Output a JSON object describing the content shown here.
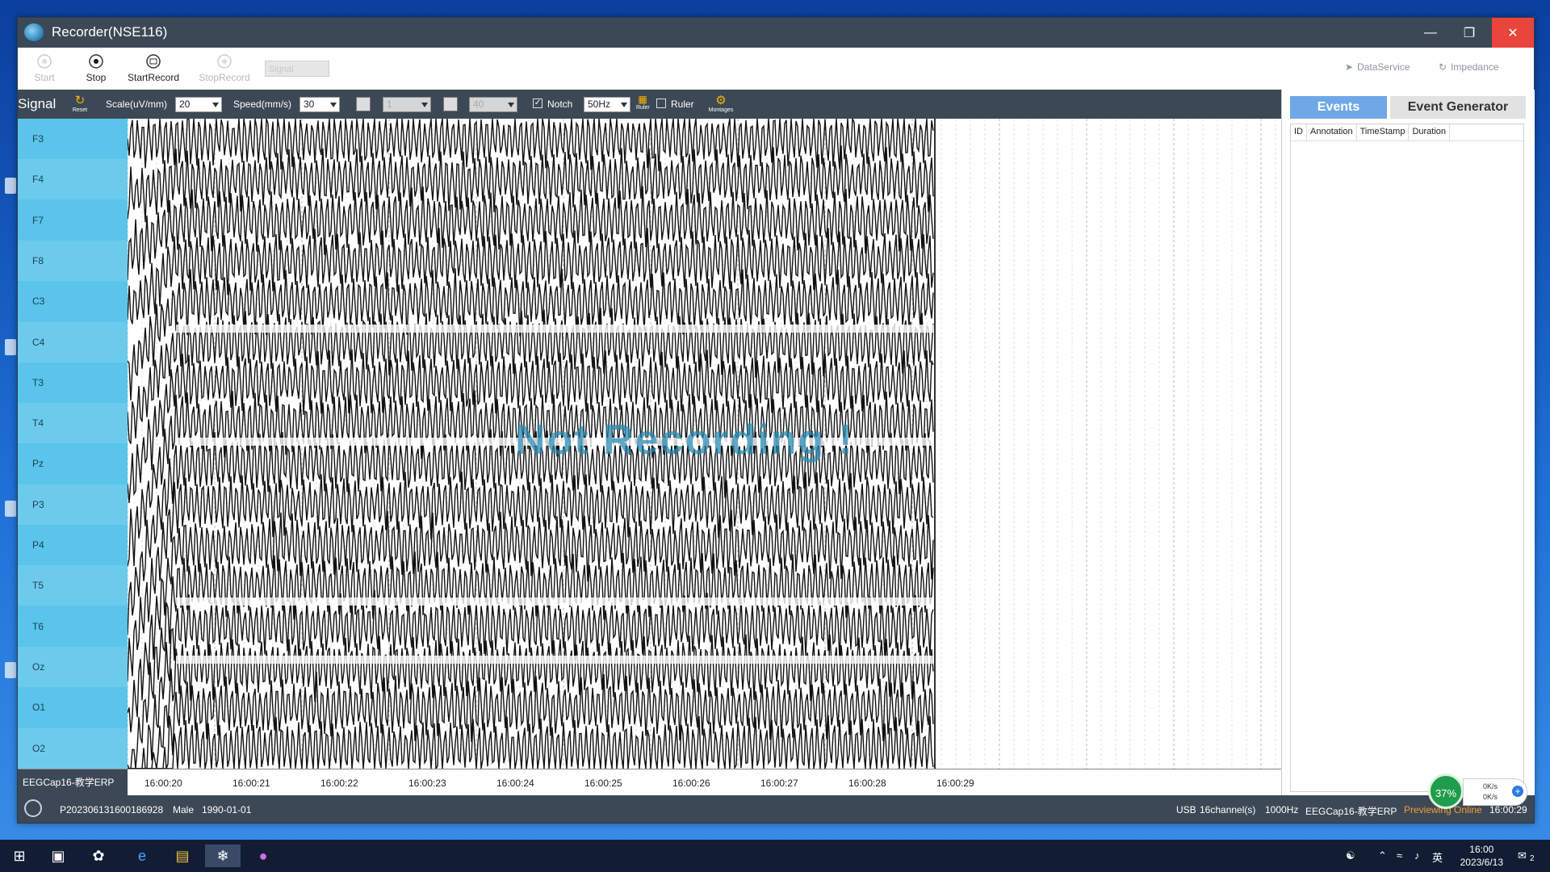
{
  "window": {
    "title": "Recorder(NSE116)"
  },
  "toolbar": {
    "start": "Start",
    "stop": "Stop",
    "start_record": "StartRecord",
    "stop_record": "StopRecord",
    "signal_combo": "Signal",
    "data_service": "DataService",
    "impedance": "Impedance"
  },
  "signal_bar": {
    "title": "Signal",
    "reset": "Reset",
    "scale_label": "Scale(uV/mm)",
    "scale_value": "20",
    "speed_label": "Speed(mm/s)",
    "speed_value": "30",
    "highpass_value": "1",
    "lowpass_value": "40",
    "notch_label": "Notch",
    "notch_checked": true,
    "notch_value": "50Hz",
    "ruler_icon_label": "Ruler",
    "ruler_label": "Ruler",
    "ruler_checked": false,
    "montages_label": "Montages"
  },
  "channels": [
    "F3",
    "F4",
    "F7",
    "F8",
    "C3",
    "C4",
    "T3",
    "T4",
    "Pz",
    "P3",
    "P4",
    "T5",
    "T6",
    "Oz",
    "O1",
    "O2"
  ],
  "plot": {
    "watermark": "Not Recording !"
  },
  "time_axis": {
    "montage": "EEGCap16-教学ERP",
    "ticks": [
      "16:00:20",
      "16:00:21",
      "16:00:22",
      "16:00:23",
      "16:00:24",
      "16:00:25",
      "16:00:26",
      "16:00:27",
      "16:00:28",
      "16:00:29"
    ]
  },
  "events_panel": {
    "tab_events": "Events",
    "tab_generator": "Event Generator",
    "columns": [
      "ID",
      "Annotation",
      "TimeStamp",
      "Duration"
    ]
  },
  "status": {
    "patient_id": "P202306131600186928",
    "sex": "Male",
    "dob": "1990-01-01",
    "device": "USB",
    "channels": "16channel(s)",
    "rate": "1000Hz",
    "montage": "EEGCap16-教学ERP",
    "mode": "Previewing Online",
    "time": "16:00:29"
  },
  "tray": {
    "cpu_percent": "37%",
    "up": "0K/s",
    "down": "0K/s",
    "ime": "英",
    "time": "16:00",
    "date": "2023/6/13",
    "notif_count": "2"
  },
  "colors": {
    "titlebar": "#3c4855",
    "channel_panel": "#5ac4ea",
    "close": "#e8453c",
    "events_tab": "#6ea8e6",
    "mode_text": "#f0a030"
  }
}
